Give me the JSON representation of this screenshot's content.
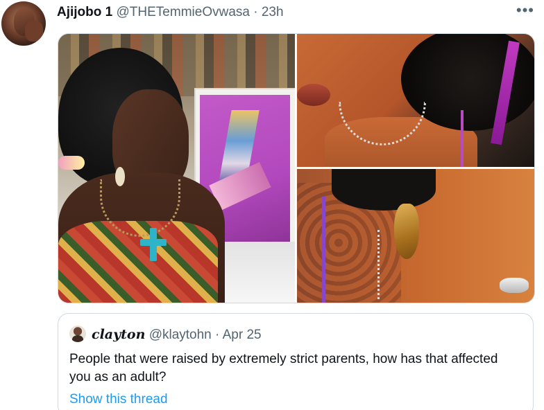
{
  "tweet": {
    "author_name": "Ajijobo 1",
    "author_handle": "@THETemmieOvwasa",
    "separator": "·",
    "time": "23h",
    "more_icon": "•••",
    "media": [
      {
        "name": "photo-woman-painting"
      },
      {
        "name": "photo-closeup-neck-chain"
      },
      {
        "name": "photo-closeup-ear-earring"
      }
    ]
  },
  "quoted_tweet": {
    "author_name": "clayton",
    "author_handle": "@klaytohn",
    "separator": "·",
    "time": "Apr 25",
    "text": "People that were raised by extremely strict parents, how has that affected you as an adult?",
    "show_thread": "Show this thread"
  },
  "colors": {
    "primary_text": "#0f1419",
    "secondary_text": "#536471",
    "link": "#1d9bf0",
    "border": "#cfd9de"
  }
}
